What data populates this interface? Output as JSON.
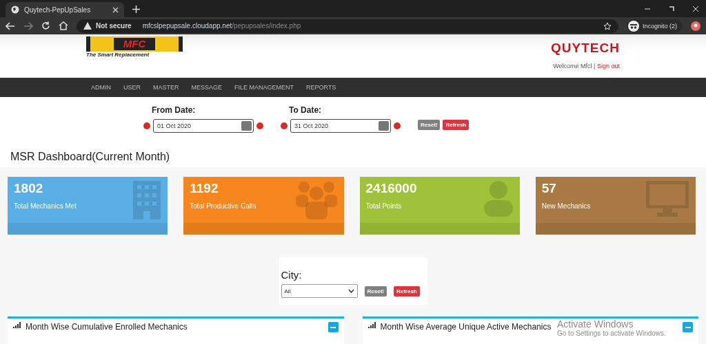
{
  "browser": {
    "tab_title": "Quytech-PepUpSales",
    "security": "Not secure",
    "url_host": "mfcslpepupsale.cloudapp.net",
    "url_path": "/pepupsales/index.php",
    "profile": "Incognito (2)"
  },
  "header": {
    "logo": "MFC",
    "tagline": "The Smart Replacement",
    "brand": "QUYTECH",
    "welcome": "Welcome Mfcl",
    "separator": "|",
    "sign_out": "Sign out"
  },
  "nav": [
    "ADMIN",
    "USER",
    "MASTER",
    "MESSAGE",
    "FILE MANAGEMENT",
    "REPORTS"
  ],
  "filters": {
    "from_label": "From Date:",
    "from_value": "01 Oct 2020",
    "to_label": "To Date:",
    "to_value": "31 Oct 2020",
    "reset": "Reset!",
    "refresh": "Refresh"
  },
  "dashboard_title": "MSR Dashboard(Current Month)",
  "cards": [
    {
      "value": "1802",
      "label": "Total Mechanics Met",
      "color": "#5aaee6",
      "kind": "building"
    },
    {
      "value": "1192",
      "label": "Total Productive Calls",
      "color": "#f7861e",
      "kind": "group"
    },
    {
      "value": "2416000",
      "label": "Total Points",
      "color": "#a0c23a",
      "kind": "person"
    },
    {
      "value": "57",
      "label": "New Mechanics",
      "color": "#a97a45",
      "kind": "monitor"
    }
  ],
  "city": {
    "label": "City:",
    "value": "All",
    "reset": "Reset!",
    "refresh": "Refresh"
  },
  "panels": [
    "Month Wise Cumulative Enrolled Mechanics",
    "Month Wise Average Unique Active Mechanics"
  ],
  "os_notice": {
    "title": "Activate Windows",
    "subtitle": "Go to Settings to activate Windows."
  }
}
